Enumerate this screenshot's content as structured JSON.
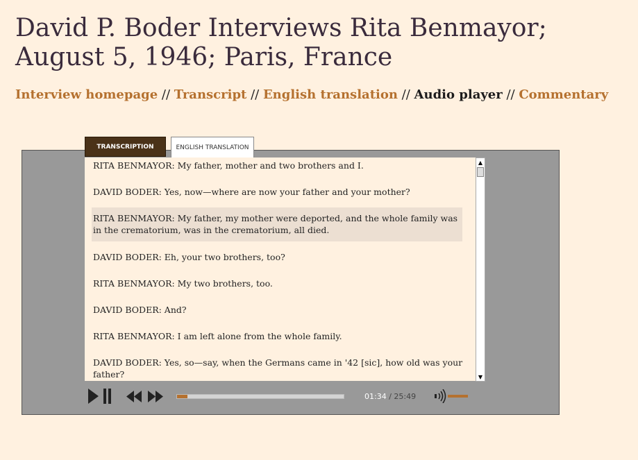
{
  "page": {
    "title": "David P. Boder Interviews Rita Benmayor; August 5, 1946; Paris, France"
  },
  "nav": {
    "interview_homepage": "Interview homepage",
    "transcript": "Transcript",
    "english_translation": "English translation",
    "audio_player": "Audio player",
    "commentary": "Commentary",
    "separator": " // "
  },
  "tabs": {
    "transcription": "TRANSCRIPTION",
    "english_translation": "ENGLISH TRANSLATION"
  },
  "transcript": {
    "lines": [
      "RITA BENMAYOR: My father, mother and two brothers and I.",
      "DAVID BODER: Yes, now—where are now your father and your mother?",
      "RITA BENMAYOR: My father, my mother were deported, and the whole family was in the crematorium, was in the crematorium, all died.",
      "DAVID BODER: Eh, your two brothers, too?",
      "RITA BENMAYOR: My two brothers, too.",
      "DAVID BODER: And?",
      "RITA BENMAYOR: I am left alone from the whole family.",
      "DAVID BODER: Yes, so—say, when the Germans came in '42 [sic], how old was your father?"
    ]
  },
  "player": {
    "current_time": "01:34",
    "time_separator": "/",
    "total_time": "25:49",
    "progress_fraction": 0.061,
    "volume_fraction": 1.0
  },
  "icons": {
    "play_pause": "play-pause-icon",
    "rewind": "rewind-icon",
    "fast_forward": "fast-forward-icon",
    "volume": "volume-icon"
  },
  "colors": {
    "background": "#fff1e0",
    "link": "#b5712f",
    "title": "#3a2b3c",
    "active_tab": "#4a3218",
    "player_panel": "#999999",
    "highlight": "#ecdfd2"
  }
}
